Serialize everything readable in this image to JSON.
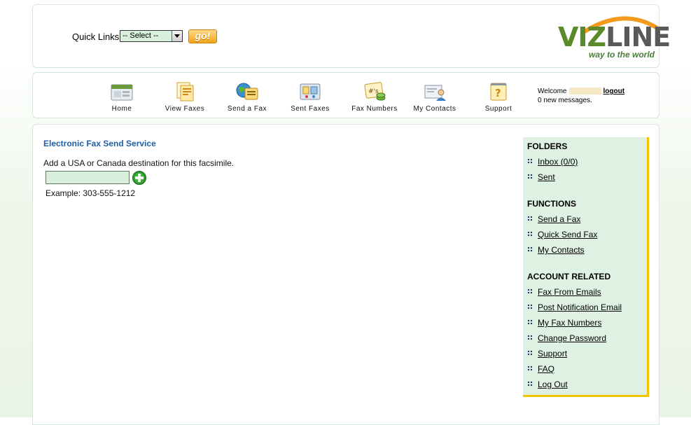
{
  "quick_links": {
    "label": "Quick Links:",
    "selected": "-- Select --",
    "go_label": "go!"
  },
  "logo": {
    "viz": "VIZ",
    "line": "LINE",
    "tagline": "way to the world",
    "brand_green": "#5a8a2a",
    "brand_orange": "#f39a1e"
  },
  "nav": {
    "items": [
      {
        "label": "Home",
        "icon": "home-icon"
      },
      {
        "label": "View Faxes",
        "icon": "view-faxes-icon"
      },
      {
        "label": "Send a Fax",
        "icon": "send-fax-icon"
      },
      {
        "label": "Sent Faxes",
        "icon": "sent-faxes-icon"
      },
      {
        "label": "Fax Numbers",
        "icon": "fax-numbers-icon"
      },
      {
        "label": "My Contacts",
        "icon": "my-contacts-icon"
      },
      {
        "label": "Support",
        "icon": "support-icon"
      }
    ],
    "welcome": "Welcome",
    "logout": "logout",
    "messages": "0 new messages."
  },
  "main": {
    "title": "Electronic Fax Send Service",
    "instruction": "Add a USA or Canada destination for this facsimile.",
    "phone_value": "",
    "example": "Example: 303-555-1212"
  },
  "sidebar": {
    "folders_heading": "FOLDERS",
    "folders": [
      "Inbox (0/0)",
      "Sent"
    ],
    "functions_heading": "FUNCTIONS",
    "functions": [
      "Send a Fax",
      "Quick Send Fax",
      "My Contacts"
    ],
    "account_heading": "ACCOUNT RELATED",
    "account": [
      "Fax From Emails",
      "Post Notification Email",
      "My Fax Numbers",
      "Change Password",
      "Support",
      "FAQ",
      "Log Out"
    ],
    "accent_color": "#f3c200"
  }
}
